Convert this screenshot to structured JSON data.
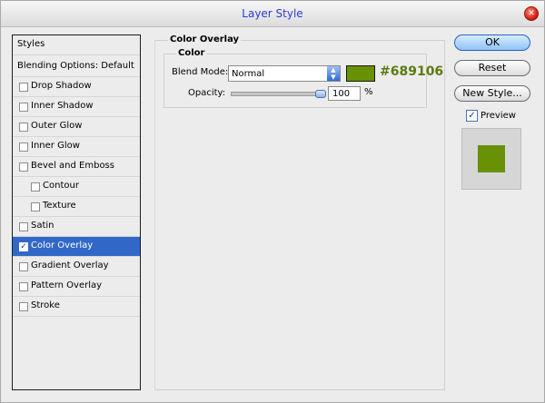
{
  "window": {
    "title": "Layer Style",
    "close_glyph": "✕"
  },
  "styles_list": {
    "header": "Styles",
    "blending_options": "Blending Options: Default",
    "items": [
      {
        "label": "Drop Shadow",
        "checked": false,
        "indent": false,
        "selected": false
      },
      {
        "label": "Inner Shadow",
        "checked": false,
        "indent": false,
        "selected": false
      },
      {
        "label": "Outer Glow",
        "checked": false,
        "indent": false,
        "selected": false
      },
      {
        "label": "Inner Glow",
        "checked": false,
        "indent": false,
        "selected": false
      },
      {
        "label": "Bevel and Emboss",
        "checked": false,
        "indent": false,
        "selected": false
      },
      {
        "label": "Contour",
        "checked": false,
        "indent": true,
        "selected": false
      },
      {
        "label": "Texture",
        "checked": false,
        "indent": true,
        "selected": false
      },
      {
        "label": "Satin",
        "checked": false,
        "indent": false,
        "selected": false
      },
      {
        "label": "Color Overlay",
        "checked": true,
        "indent": false,
        "selected": true
      },
      {
        "label": "Gradient Overlay",
        "checked": false,
        "indent": false,
        "selected": false
      },
      {
        "label": "Pattern Overlay",
        "checked": false,
        "indent": false,
        "selected": false
      },
      {
        "label": "Stroke",
        "checked": false,
        "indent": false,
        "selected": false
      }
    ]
  },
  "color_overlay": {
    "group_title": "Color Overlay",
    "subgroup_title": "Color",
    "blend_mode_label": "Blend Mode:",
    "blend_mode_value": "Normal",
    "color_hex": "#689106",
    "opacity_label": "Opacity:",
    "opacity_value": "100",
    "opacity_percent": 100,
    "opacity_unit": "%"
  },
  "buttons": {
    "ok": "OK",
    "reset": "Reset",
    "new_style": "New Style..."
  },
  "preview": {
    "label": "Preview",
    "checked": true
  },
  "colors": {
    "overlay": "#689106",
    "selection": "#3168c8",
    "title_text": "#2a3ad0"
  }
}
